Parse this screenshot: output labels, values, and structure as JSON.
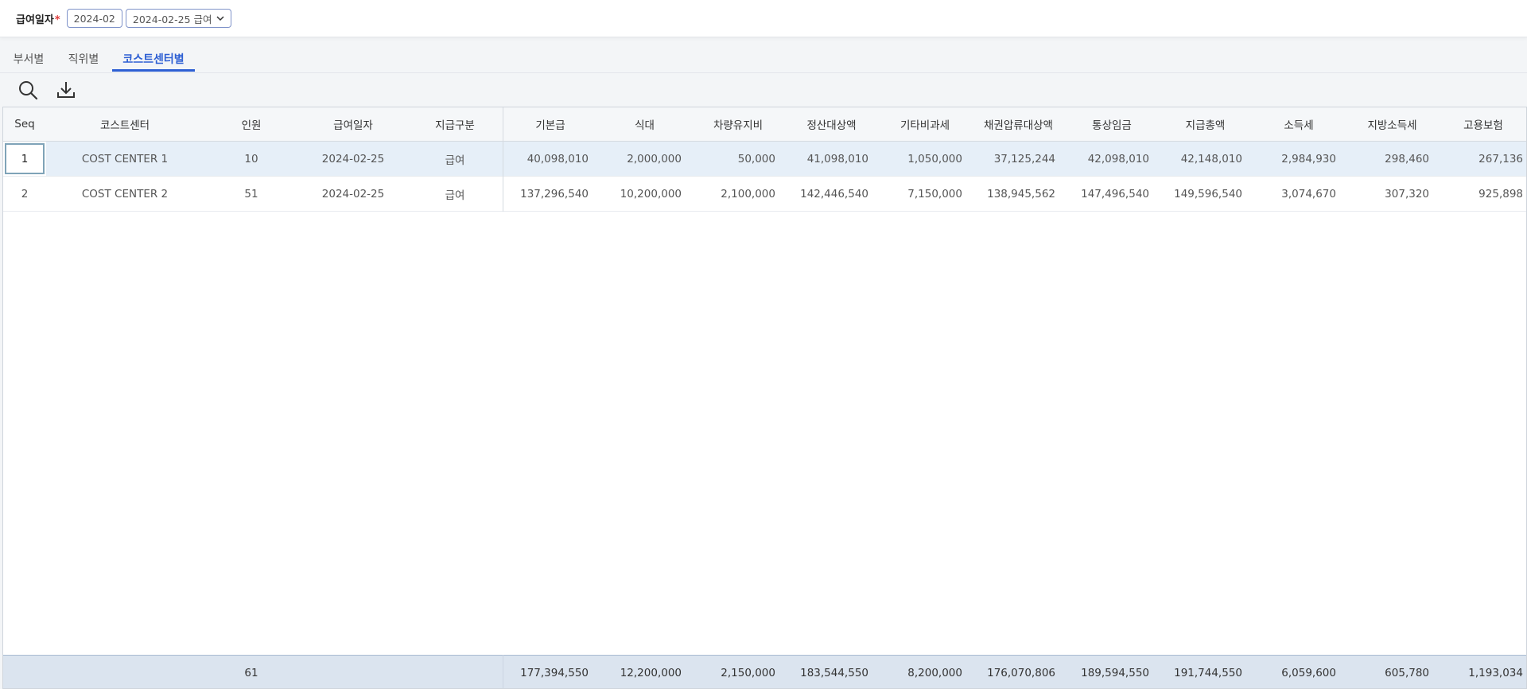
{
  "filter": {
    "label": "급여일자",
    "required_mark": "*",
    "month": "2024-02",
    "pay_select": "2024-02-25 급여"
  },
  "tabs": [
    "부서별",
    "직위별",
    "코스트센터별"
  ],
  "active_tab": 2,
  "toolbar": {
    "search_icon": "search-icon",
    "download_icon": "download-icon"
  },
  "table": {
    "columns": [
      "Seq",
      "코스트센터",
      "인원",
      "급여일자",
      "지급구분",
      "기본급",
      "식대",
      "차량유지비",
      "정산대상액",
      "기타비과세",
      "채권압류대상액",
      "통상임금",
      "지급총액",
      "소득세",
      "지방소득세",
      "고용보험"
    ],
    "rows": [
      [
        "1",
        "COST CENTER 1",
        "10",
        "2024-02-25",
        "급여",
        "40,098,010",
        "2,000,000",
        "50,000",
        "41,098,010",
        "1,050,000",
        "37,125,244",
        "42,098,010",
        "42,148,010",
        "2,984,930",
        "298,460",
        "267,136"
      ],
      [
        "2",
        "COST CENTER 2",
        "51",
        "2024-02-25",
        "급여",
        "137,296,540",
        "10,200,000",
        "2,100,000",
        "142,446,540",
        "7,150,000",
        "138,945,562",
        "147,496,540",
        "149,596,540",
        "3,074,670",
        "307,320",
        "925,898"
      ]
    ],
    "footer": [
      "",
      "",
      "61",
      "",
      "",
      "177,394,550",
      "12,200,000",
      "2,150,000",
      "183,544,550",
      "8,200,000",
      "176,070,806",
      "189,594,550",
      "191,744,550",
      "6,059,600",
      "605,780",
      "1,193,034"
    ]
  }
}
